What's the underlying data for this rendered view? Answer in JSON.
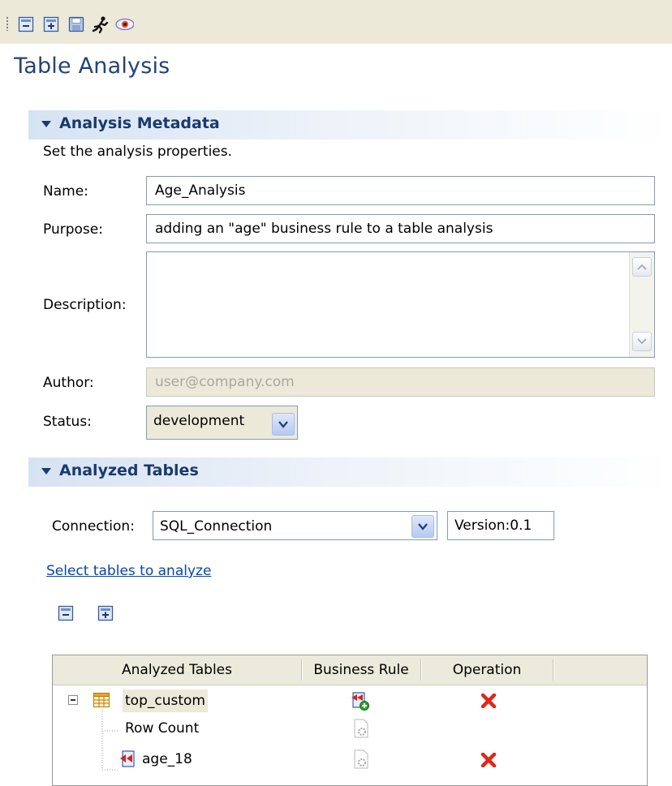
{
  "toolbar": {
    "icons": [
      "collapse-all-icon",
      "expand-all-icon",
      "save-icon",
      "run-icon",
      "view-icon"
    ]
  },
  "page_title": "Table Analysis",
  "metadata_section": {
    "title": "Analysis Metadata",
    "subtitle": "Set the analysis properties.",
    "name_label": "Name:",
    "name_value": "Age_Analysis",
    "purpose_label": "Purpose:",
    "purpose_value": "adding an \"age\" business rule to a table analysis",
    "description_label": "Description:",
    "description_value": "",
    "author_label": "Author:",
    "author_value": "user@company.com",
    "status_label": "Status:",
    "status_value": "development"
  },
  "tables_section": {
    "title": "Analyzed Tables",
    "connection_label": "Connection:",
    "connection_value": "SQL_Connection",
    "version_value": "Version:0.1",
    "select_link": "Select tables to analyze",
    "table": {
      "columns": [
        "Analyzed Tables",
        "Business Rule",
        "Operation"
      ],
      "rows": [
        {
          "name": "top_custom",
          "level": 0,
          "expander": "−"
        },
        {
          "name": "Row Count",
          "level": 1
        },
        {
          "name": "age_18",
          "level": 1
        }
      ]
    }
  },
  "colors": {
    "title_blue": "#23447a",
    "section_blue": "#1a3a6e",
    "delete_red": "#e3251b",
    "link_blue": "#0645ad"
  }
}
